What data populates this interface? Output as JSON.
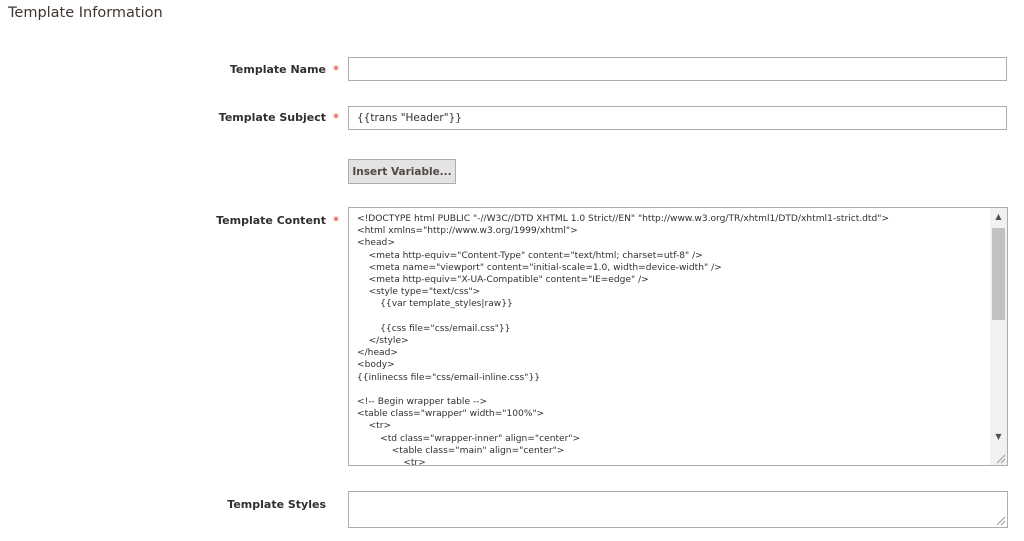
{
  "section": {
    "title": "Template Information"
  },
  "fields": {
    "name": {
      "label": "Template Name",
      "required_mark": "*",
      "value": ""
    },
    "subject": {
      "label": "Template Subject",
      "required_mark": "*",
      "value": "{{trans \"Header\"}}"
    },
    "insert_variable": {
      "label": "Insert Variable..."
    },
    "content": {
      "label": "Template Content",
      "required_mark": "*",
      "lines": [
        "<!DOCTYPE html PUBLIC \"-//W3C//DTD XHTML 1.0 Strict//EN\" \"http://www.w3.org/TR/xhtml1/DTD/xhtml1-strict.dtd\">",
        "<html xmlns=\"http://www.w3.org/1999/xhtml\">",
        "<head>",
        "    <meta http-equiv=\"Content-Type\" content=\"text/html; charset=utf-8\" />",
        "    <meta name=\"viewport\" content=\"initial-scale=1.0, width=device-width\" />",
        "    <meta http-equiv=\"X-UA-Compatible\" content=\"IE=edge\" />",
        "    <style type=\"text/css\">",
        "        {{var template_styles|raw}}",
        "",
        "        {{css file=\"css/email.css\"}}",
        "    </style>",
        "</head>",
        "<body>",
        "{{inlinecss file=\"css/email-inline.css\"}}",
        "",
        "<!-- Begin wrapper table -->",
        "<table class=\"wrapper\" width=\"100%\">",
        "    <tr>",
        "        <td class=\"wrapper-inner\" align=\"center\">",
        "            <table class=\"main\" align=\"center\">",
        "                <tr>"
      ]
    },
    "styles": {
      "label": "Template Styles",
      "value": ""
    }
  }
}
